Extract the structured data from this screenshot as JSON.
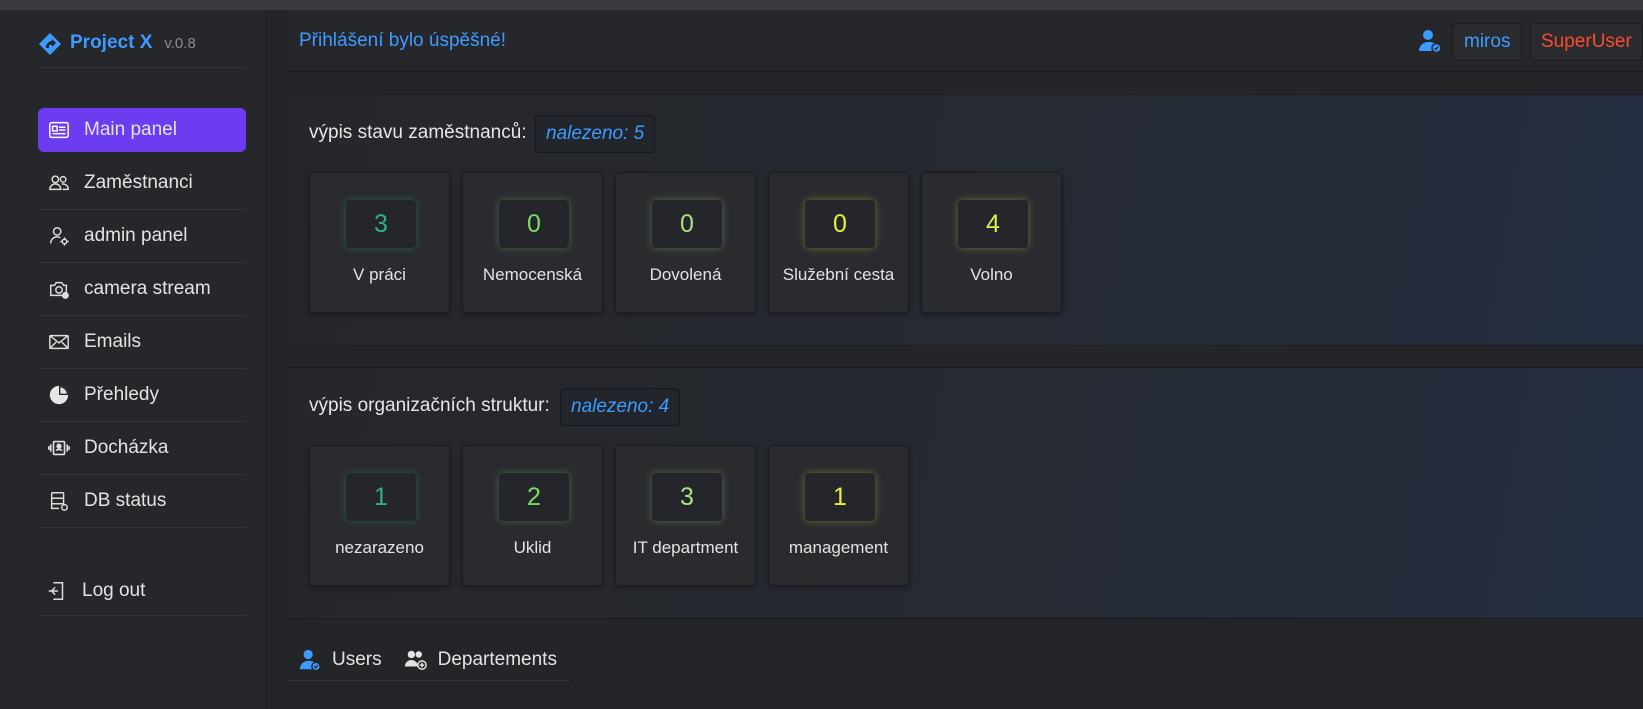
{
  "app": {
    "name": "Project X",
    "version": "v.0.8",
    "accent": "#3d9bff",
    "active_nav": "#6c3df0"
  },
  "sidebar": {
    "items": [
      {
        "label": "Main panel",
        "icon": "id-card-icon",
        "active": true
      },
      {
        "label": "Zaměstnanci",
        "icon": "users-icon"
      },
      {
        "label": "admin panel",
        "icon": "user-gear-icon"
      },
      {
        "label": "camera stream",
        "icon": "camera-icon"
      },
      {
        "label": "Emails",
        "icon": "envelope-icon"
      },
      {
        "label": "Přehledy",
        "icon": "pie-chart-icon"
      },
      {
        "label": "Docházka",
        "icon": "attendance-icon"
      },
      {
        "label": "DB status",
        "icon": "database-icon"
      }
    ],
    "logout": "Log out"
  },
  "header": {
    "message": "Přihlášení bylo úspěšné!",
    "user": "miros",
    "role": "SuperUser"
  },
  "employees": {
    "title": "výpis stavu zaměstnanců:",
    "found": "nalezeno: 5",
    "cards": [
      {
        "value": "3",
        "label": "V práci",
        "color": "#2fb380"
      },
      {
        "value": "0",
        "label": "Nemocenská",
        "color": "#7ddc62"
      },
      {
        "value": "0",
        "label": "Dovolená",
        "color": "#a9e27a"
      },
      {
        "value": "0",
        "label": "Služební cesta",
        "color": "#e8f03a"
      },
      {
        "value": "4",
        "label": "Volno",
        "color": "#d7f04a"
      }
    ]
  },
  "departments": {
    "title": "výpis organizačních struktur:",
    "found": "nalezeno: 4",
    "cards": [
      {
        "value": "1",
        "label": "nezarazeno",
        "color": "#2fb380"
      },
      {
        "value": "2",
        "label": "Uklid",
        "color": "#7ddc62"
      },
      {
        "value": "3",
        "label": "IT department",
        "color": "#a9e27a"
      },
      {
        "value": "1",
        "label": "management",
        "color": "#e8f03a"
      }
    ]
  },
  "tabs": [
    {
      "label": "Users",
      "icon": "user-check-icon"
    },
    {
      "label": "Departements",
      "icon": "users-plus-icon"
    }
  ]
}
